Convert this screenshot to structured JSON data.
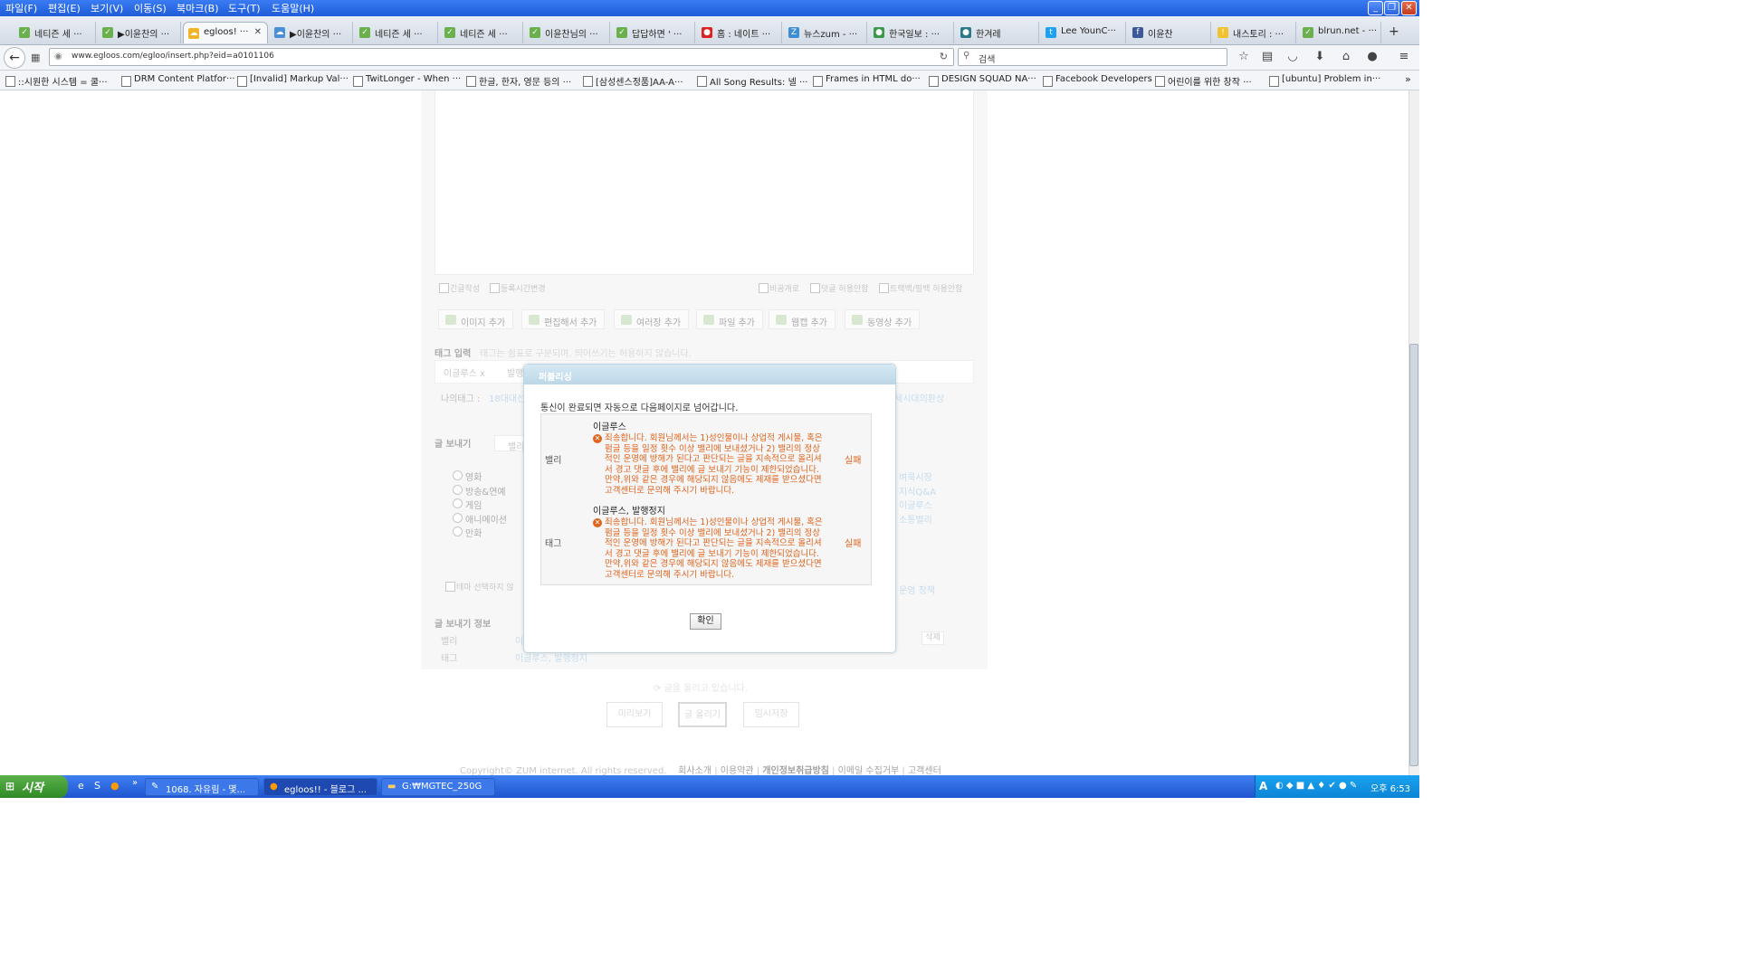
{
  "menubar": {
    "items": [
      "파일(F)",
      "편집(E)",
      "보기(V)",
      "이동(S)",
      "북마크(B)",
      "도구(T)",
      "도움말(H)"
    ]
  },
  "tabs": [
    {
      "label": "네티즌 세 ···",
      "icon": "leaf"
    },
    {
      "label": "▶이윤찬의 ···",
      "icon": "leaf"
    },
    {
      "label": "egloos! ···",
      "icon": "egloos",
      "active": true
    },
    {
      "label": "▶이윤찬의 ···",
      "icon": "egloos"
    },
    {
      "label": "네티즌 세 ···",
      "icon": "leaf"
    },
    {
      "label": "네티즌 세 ···",
      "icon": "leaf"
    },
    {
      "label": "이윤찬님의 ···",
      "icon": "leaf"
    },
    {
      "label": "답답하면 ' ···",
      "icon": "leaf"
    },
    {
      "label": "홈 : 네이트 ···",
      "icon": "nate"
    },
    {
      "label": "뉴스zum - ···",
      "icon": "zum"
    },
    {
      "label": "한국일보 : ···",
      "icon": "hankook"
    },
    {
      "label": "한겨레",
      "icon": "hani"
    },
    {
      "label": "Lee YounC···",
      "icon": "twitter"
    },
    {
      "label": "이윤찬",
      "icon": "facebook"
    },
    {
      "label": "내스토리 : ···",
      "icon": "story"
    },
    {
      "label": "blrun.net - ···",
      "icon": "leaf"
    }
  ],
  "navbar": {
    "url": "www.egloos.com/egloo/insert.php?eid=a0101106",
    "search_placeholder": "검색"
  },
  "bookmarks": [
    "::시원한 시스템 = 쿨···",
    "DRM Content Platfor···",
    "[Invalid] Markup Val···",
    "TwitLonger - When ···",
    "한글, 한자, 영문 등의 ···",
    "[삼성센스정품]AA-A···",
    "All Song Results: 넬 ···",
    "Frames in HTML do···",
    "DESIGN SQUAD NA···",
    "Facebook Developers",
    "어린이를 위한 창작 ···",
    "[ubuntu] Problem in···"
  ],
  "editor": {
    "options_left": [
      "긴글작성",
      "등록시간변경"
    ],
    "options_right": [
      "비공개로",
      "덧글 허용안함",
      "트랙백/핑백 허용안함"
    ],
    "add_buttons": [
      "이미지 추가",
      "편집해서 추가",
      "여러장 추가",
      "파일 추가",
      "웹캡 추가",
      "동영상 추가"
    ],
    "tag_label": "태그 입력",
    "tag_hint": "태그는 쉼표로 구분되며, 띄어쓰기는 허용하지 않습니다.",
    "tag_chips": [
      "이글루스 x",
      "발행"
    ],
    "my_tags_label": "나의태그 :",
    "my_tags_first": "18대대선",
    "my_tags_last": "세시대의환상",
    "send_label": "글 보내기",
    "send_tab": "밸리",
    "themes_left": [
      "영화",
      "방송&연예",
      "게임",
      "애니메이션",
      "만화"
    ],
    "themes_right": [
      "벼룩시장",
      "지식Q&A",
      "이글루스",
      "소통밸리"
    ],
    "no_theme": "테마 선택하지 않",
    "policy_link": "운영 정책",
    "send_info_label": "글 보내기 정보",
    "info_rows": [
      {
        "label": "밸리",
        "value": "이"
      },
      {
        "label": "태그",
        "value": "이글루스, 발행정지"
      }
    ],
    "delete_btn": "삭제",
    "posting_status": "글을 올리고 있습니다.",
    "buttons": [
      "미리보기",
      "글 올리기",
      "임시저장"
    ]
  },
  "dialog": {
    "title": "퍼블리싱",
    "message": "통신이 완료되면 자동으로 다음페이지로 넘어갑니다.",
    "rows": [
      {
        "label": "밸리",
        "heading": "이글루스",
        "error": "죄송합니다. 회원님께서는 1)성인물이나 상업적 게시물, 혹은 펌글 등을 일정 횟수 이상 밸리에 보내셨거나 2) 밸리의 정상적인 운영에 방해가 된다고 판단되는 글을 지속적으로 올리셔서 경고 댓글 후에 밸리에 글 보내기 기능이 제한되었습니다. 만약,위와 같은 경우에 해당되지 않음에도 제재를 받으셨다면 고객센터로 문의해 주시기 바랍니다.",
        "status": "실패"
      },
      {
        "label": "태그",
        "heading": "이글루스, 발행정지",
        "error": "죄송합니다. 회원님께서는 1)성인물이나 상업적 게시물, 혹은 펌글 등을 일정 횟수 이상 밸리에 보내셨거나 2) 밸리의 정상적인 운영에 방해가 된다고 판단되는 글을 지속적으로 올리셔서 경고 댓글 후에 밸리에 글 보내기 기능이 제한되었습니다. 만약,위와 같은 경우에 해당되지 않음에도 제재를 받으셨다면 고객센터로 문의해 주시기 바랍니다.",
        "status": "실패"
      }
    ],
    "ok_label": "확인"
  },
  "footer": {
    "copyright": "Copyright© ZUM internet. All rights reserved.",
    "links": [
      "회사소개",
      "이용약관",
      "개인정보취급방침",
      "이메일 수집거부",
      "고객센터"
    ]
  },
  "taskbar": {
    "start_label": "시작",
    "tasks": [
      "1068. 자유림 - 몇...",
      "egloos!! - 블로그 ...",
      "G:₩MGTEC_250G"
    ],
    "clock": "오후 6:53"
  },
  "colors": {
    "error": "#e0631c",
    "dialog_header": "#bcd7e8",
    "taskbar": "#1f55d0",
    "link": "#5a9bd8"
  }
}
